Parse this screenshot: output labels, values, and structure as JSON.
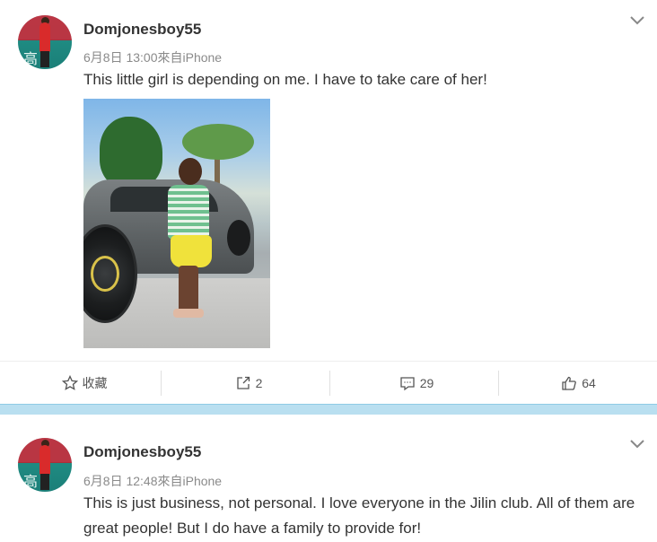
{
  "posts": [
    {
      "username": "Domjonesboy55",
      "meta": "6月8日 13:00來自iPhone",
      "text": "This little girl is depending on me. I have to take care of her!",
      "actions": {
        "favorite_label": "收藏",
        "repost_count": "2",
        "comment_count": "29",
        "like_count": "64"
      }
    },
    {
      "username": "Domjonesboy55",
      "meta": "6月8日 12:48來自iPhone",
      "text": "This is just business, not personal. I love everyone in the Jilin club. All of them are great people! But I do have a family to provide for!"
    }
  ],
  "avatar": {
    "sign_text": "高 古"
  },
  "icons": {
    "expand": "chevron-down-icon",
    "favorite": "star-icon",
    "repost": "share-icon",
    "comment": "comment-icon",
    "like": "thumbs-up-icon"
  },
  "colors": {
    "band": "#b9dff0",
    "text": "#333333",
    "meta": "#8a8a8a"
  }
}
